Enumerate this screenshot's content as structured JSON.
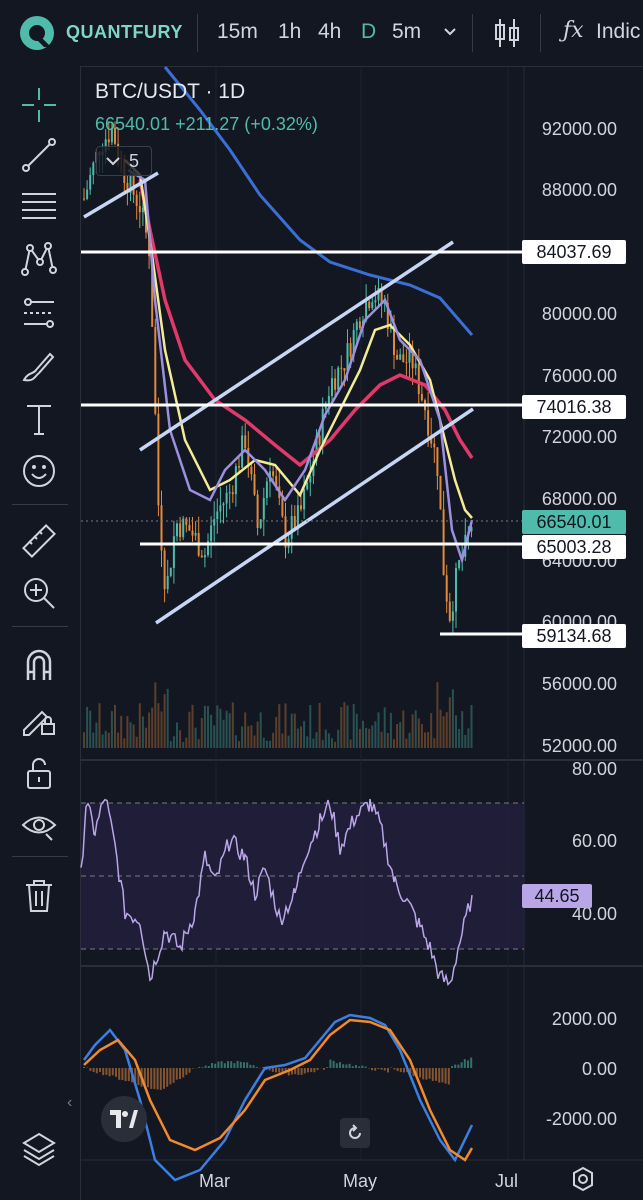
{
  "topbar": {
    "brand": "QUANTFURY",
    "timeframes": [
      "15m",
      "1h",
      "4h",
      "D",
      "5m"
    ],
    "active_timeframe": "D",
    "indicators_label": "Indic"
  },
  "chart": {
    "symbol": "BTC/USDT · 1D",
    "price_line": "66540.01  +211.27 (+0.32%)",
    "price_lines_count": "5",
    "price_axis": [
      "92000.00",
      "88000.00",
      "80000.00",
      "76000.00",
      "72000.00",
      "68000.00",
      "64000.00",
      "60000.00",
      "56000.00",
      "52000.00"
    ],
    "price_labels": {
      "level_84037": "84037.69",
      "level_74016": "74016.38",
      "current": "66540.01",
      "level_65003": "65003.28",
      "level_59134": "59134.68"
    },
    "rsi_axis": [
      "80.00",
      "60.00",
      "40.00"
    ],
    "rsi_value": "44.65",
    "macd_axis": [
      "2000.00",
      "0.00",
      "-2000.00"
    ],
    "time_axis": [
      "Mar",
      "May",
      "Jul"
    ]
  },
  "colors": {
    "background": "#131722",
    "accent": "#4fbcab",
    "ma_blue": "#3b6fd6",
    "ma_red": "#e03a6a",
    "ma_yellow": "#f4eb95",
    "ma_purple": "#9d8fe0",
    "candle_up": "#4fbcab",
    "candle_down": "#e2893a",
    "rsi_line": "#b8a6e6",
    "macd_line": "#3c7fe0",
    "signal_line": "#f08a2c"
  },
  "sidebar": {
    "tools": [
      "crosshair-icon",
      "trendline-icon",
      "fib-icon",
      "pattern-icon",
      "prediction-icon",
      "brush-icon",
      "text-icon",
      "emoji-icon",
      "ruler-icon",
      "zoom-in-icon",
      "magnet-icon",
      "lock-drawing-icon",
      "unlock-icon",
      "eye-icon",
      "trash-icon",
      "layers-icon"
    ]
  }
}
